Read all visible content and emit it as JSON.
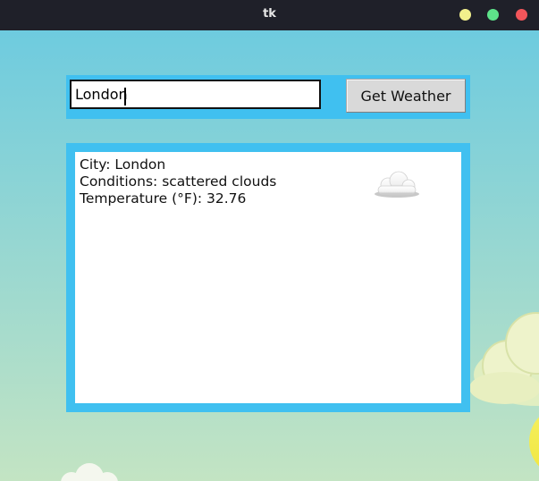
{
  "window": {
    "title": "tk",
    "controls": {
      "minimize_color": "#f2f08c",
      "maximize_color": "#5ee38a",
      "close_color": "#f2555a"
    }
  },
  "colors": {
    "frame_accent": "#40c0f0",
    "sky_top": "#6ecbdf",
    "sky_bottom": "#c3e4c3"
  },
  "search": {
    "value": "London",
    "button_label": "Get Weather"
  },
  "result": {
    "city_line": "City: London",
    "conditions_line": "Conditions: scattered clouds",
    "temperature_line": "Temperature (°F): 32.76",
    "icon": "cloud-icon"
  }
}
